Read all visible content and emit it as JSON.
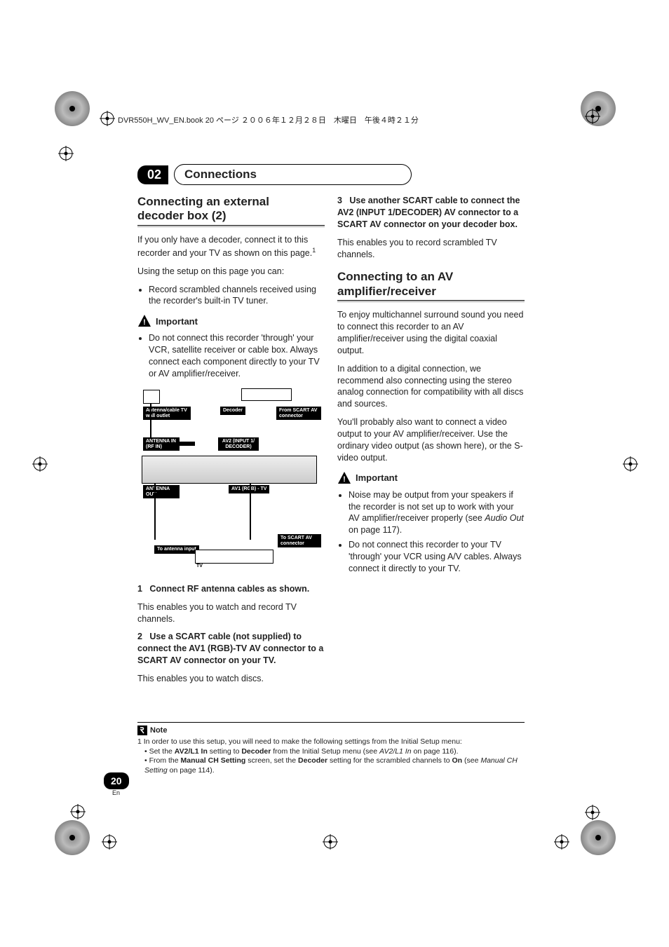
{
  "header": {
    "book_line": "DVR550H_WV_EN.book  20 ページ  ２００６年１２月２８日　木曜日　午後４時２１分"
  },
  "chapter": {
    "num": "02",
    "title": "Connections"
  },
  "left": {
    "h_a": "Connecting an external",
    "h_b": "decoder box (2)",
    "p1": "If you only have a decoder, connect it to this recorder and your TV as shown on this page.",
    "sup1": "1",
    "p2": "Using the setup on this page you can:",
    "bullet1": "Record scrambled channels received using the recorder's built-in TV tuner.",
    "important": "Important",
    "imp_bullet": "Do not connect this recorder 'through' your VCR, satellite receiver or cable box. Always connect each component directly to your TV or AV amplifier/receiver.",
    "s1_num": "1",
    "s1_title": "Connect RF antenna cables as shown.",
    "s1_body": "This enables you to watch and record TV channels.",
    "s2_num": "2",
    "s2_title": "Use a SCART cable (not supplied) to connect the AV1 (RGB)-TV AV connector to a SCART AV connector on your TV.",
    "s2_body": "This enables you to watch discs."
  },
  "right": {
    "s3_num": "3",
    "s3_title": "Use another SCART cable to connect the AV2 (INPUT 1/DECODER) AV connector to a SCART AV connector on your decoder box.",
    "s3_body": "This enables you to record scrambled TV channels.",
    "h_a": "Connecting to an AV",
    "h_b": "amplifier/receiver",
    "p1": "To enjoy multichannel surround sound you need to connect this recorder to an AV amplifier/receiver using the digital coaxial output.",
    "p2": "In addition to a digital connection, we recommend also connecting using the stereo analog connection for compatibility with all discs and sources.",
    "p3": "You'll probably also want to connect a video output to your AV amplifier/receiver. Use the ordinary video output (as shown here), or the S-video output.",
    "important": "Important",
    "imp_b1_a": "Noise may be output from your speakers if the recorder is not set up to work with your AV amplifier/receiver properly (see ",
    "imp_b1_i": "Audio Out",
    "imp_b1_b": " on page 117).",
    "imp_b2": "Do not connect this recorder to your TV 'through' your VCR using A/V cables. Always connect it directly to your TV."
  },
  "diagram": {
    "wall": "Antenna/cable TV wall outlet",
    "decoder": "Decoder",
    "from_scart": "From SCART AV connector",
    "ant_in": "ANTENNA IN (RF IN)",
    "av2": "AV2 (INPUT 1/ DECODER)",
    "ant_out": "ANTENNA OUT",
    "av1": "AV1 (RGB) - TV",
    "to_scart": "To SCART AV connector",
    "to_ant": "To antenna input",
    "tv": "TV"
  },
  "note": {
    "label": "Note",
    "line1": "1 In order to use this setup, you will need to make the following settings from the Initial Setup menu:",
    "b2a": "• Set the ",
    "b2b": "AV2/L1 In",
    "b2c": " setting to ",
    "b2d": "Decoder",
    "b2e": " from the Initial Setup menu (see ",
    "b2f": "AV2/L1 In",
    "b2g": " on page 116).",
    "b3a": "• From the ",
    "b3b": "Manual CH Setting",
    "b3c": " screen, set the ",
    "b3d": "Decoder",
    "b3e": " setting for the scrambled channels to ",
    "b3f": "On",
    "b3g": " (see ",
    "b3h": "Manual CH Setting",
    "b3i": " on page 114)."
  },
  "page": {
    "num": "20",
    "lang": "En"
  }
}
